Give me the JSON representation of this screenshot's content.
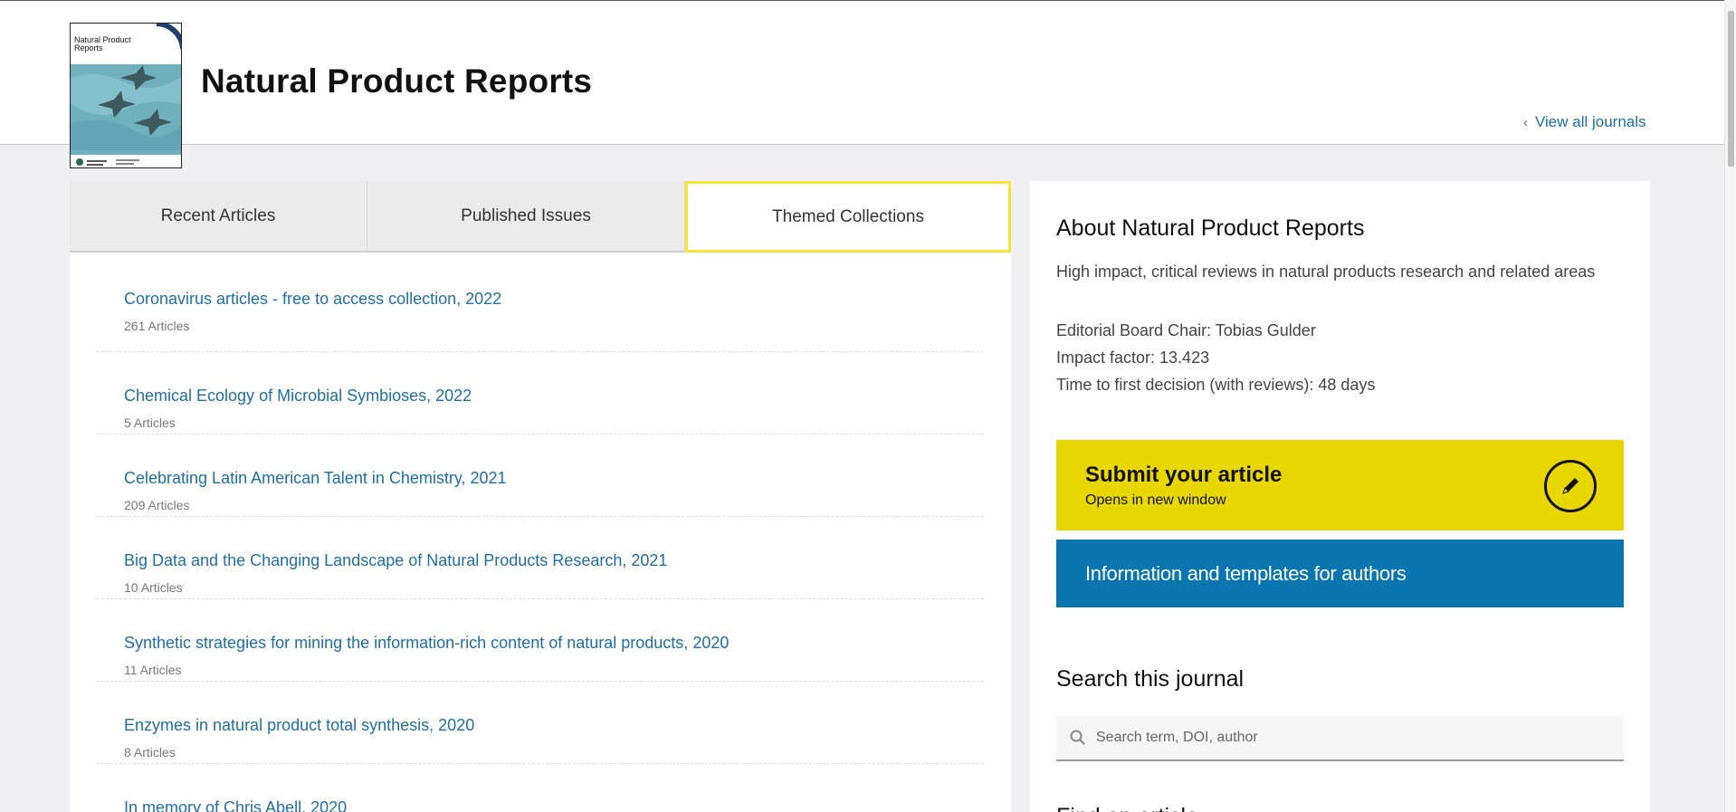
{
  "journal": {
    "title": "Natural Product Reports",
    "cover_text": "Natural Product Reports",
    "view_all": "View all journals"
  },
  "tabs": [
    {
      "label": "Recent Articles"
    },
    {
      "label": "Published Issues"
    },
    {
      "label": "Themed Collections"
    }
  ],
  "collections": [
    {
      "title": "Coronavirus articles - free to access collection, 2022",
      "count": "261 Articles"
    },
    {
      "title": "Chemical Ecology of Microbial Symbioses, 2022",
      "count": "5 Articles"
    },
    {
      "title": "Celebrating Latin American Talent in Chemistry, 2021",
      "count": "209 Articles"
    },
    {
      "title": "Big Data and the Changing Landscape of Natural Products Research, 2021",
      "count": "10 Articles"
    },
    {
      "title": "Synthetic strategies for mining the information-rich content of natural products, 2020",
      "count": "11 Articles"
    },
    {
      "title": "Enzymes in natural product total synthesis, 2020",
      "count": "8 Articles"
    },
    {
      "title": "In memory of Chris Abell, 2020",
      "count": ""
    }
  ],
  "about": {
    "title": "About Natural Product Reports",
    "description": "High impact, critical reviews in natural products research and related areas",
    "chair": "Editorial Board Chair: Tobias Gulder",
    "impact": "Impact factor: 13.423",
    "decision": "Time to first decision (with reviews): 48 days"
  },
  "submit": {
    "label": "Submit your article",
    "sub": "Opens in new window"
  },
  "info_button": "Information and templates for authors",
  "search": {
    "title": "Search this journal",
    "placeholder": "Search term, DOI, author"
  },
  "cut_heading": "Find an article",
  "colors": {
    "link": "#1c6fa8",
    "submit_bg": "#e8d700",
    "info_bg": "#0a76b0",
    "active_tab_border": "#f6e437"
  }
}
